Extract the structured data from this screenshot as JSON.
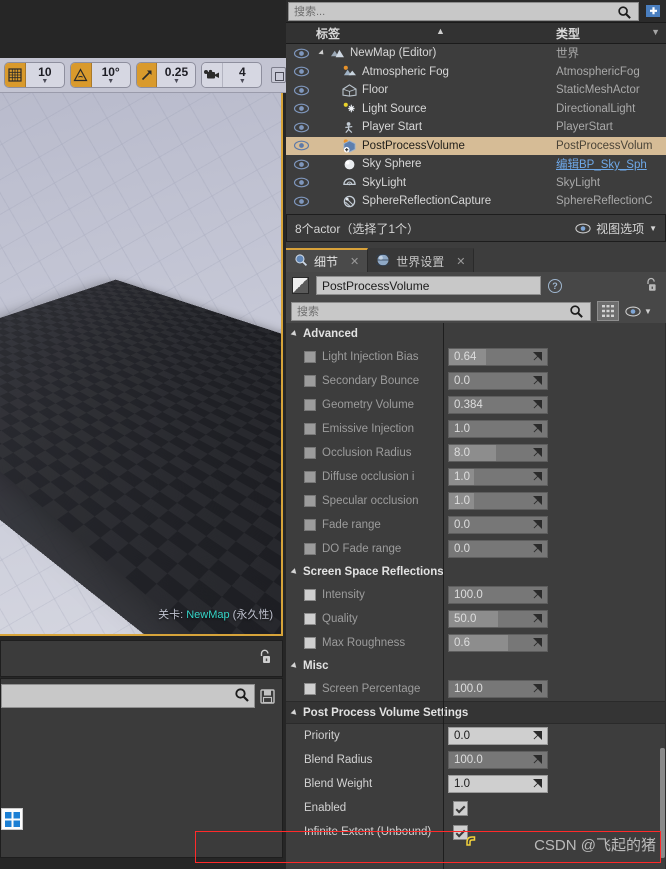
{
  "viewport_toolbar": {
    "grid_snap": {
      "icon": "grid-icon",
      "value": "10"
    },
    "angle_snap": {
      "icon": "angle-icon",
      "value": "10°"
    },
    "scale_snap": {
      "icon": "scale-arrow-icon",
      "value": "0.25"
    },
    "camera_speed": {
      "icon": "camera-icon",
      "value": "4"
    }
  },
  "viewport": {
    "level_prefix": "关卡:",
    "level_name": "NewMap",
    "level_suffix": "(永久性)"
  },
  "outliner": {
    "search_placeholder": "搜索...",
    "search_value": "",
    "columns": {
      "label": "标签",
      "type": "类型"
    },
    "rows": [
      {
        "name": "NewMap (Editor)",
        "type": "世界",
        "indent": 0,
        "icon": "world-icon",
        "selected": false,
        "link": false
      },
      {
        "name": "Atmospheric Fog",
        "type": "AtmosphericFog",
        "indent": 1,
        "icon": "fog-icon",
        "selected": false,
        "link": false
      },
      {
        "name": "Floor",
        "type": "StaticMeshActor",
        "indent": 1,
        "icon": "mesh-icon",
        "selected": false,
        "link": false
      },
      {
        "name": "Light Source",
        "type": "DirectionalLight",
        "indent": 1,
        "icon": "light-icon",
        "selected": false,
        "link": false
      },
      {
        "name": "Player Start",
        "type": "PlayerStart",
        "indent": 1,
        "icon": "player-icon",
        "selected": false,
        "link": false
      },
      {
        "name": "PostProcessVolume",
        "type": "PostProcessVolum",
        "indent": 1,
        "icon": "volume-icon",
        "selected": true,
        "link": false
      },
      {
        "name": "Sky Sphere",
        "type": "编辑BP_Sky_Sph",
        "indent": 1,
        "icon": "sphere-icon",
        "selected": false,
        "link": true
      },
      {
        "name": "SkyLight",
        "type": "SkyLight",
        "indent": 1,
        "icon": "skylight-icon",
        "selected": false,
        "link": false
      },
      {
        "name": "SphereReflectionCapture",
        "type": "SphereReflectionC",
        "indent": 1,
        "icon": "reflection-icon",
        "selected": false,
        "link": false
      }
    ],
    "footer_status": "8个actor（选择了1个）",
    "footer_viewoptions": "视图选项"
  },
  "details": {
    "tabs": [
      {
        "label": "细节",
        "icon": "magnifier-info-icon",
        "active": true
      },
      {
        "label": "世界设置",
        "icon": "globe-icon",
        "active": false
      }
    ],
    "object_name": "PostProcessVolume",
    "search_placeholder": "搜索",
    "search_value": "",
    "sections": [
      {
        "title": "Advanced",
        "band": false,
        "rows": [
          {
            "label": "Light Injection Bias",
            "value": "0.64",
            "fill": 38,
            "checkbox": "gray",
            "bright": false
          },
          {
            "label": "Secondary Bounce",
            "value": "0.0",
            "fill": 0,
            "checkbox": "gray",
            "bright": false
          },
          {
            "label": "Geometry Volume",
            "value": "0.384",
            "fill": 0,
            "checkbox": "gray",
            "bright": false
          },
          {
            "label": "Emissive Injection",
            "value": "1.0",
            "fill": 0,
            "checkbox": "gray",
            "bright": false
          },
          {
            "label": "Occlusion Radius",
            "value": "8.0",
            "fill": 48,
            "checkbox": "gray",
            "bright": false
          },
          {
            "label": "Diffuse occlusion i",
            "value": "1.0",
            "fill": 25,
            "checkbox": "gray",
            "bright": false
          },
          {
            "label": "Specular occlusion",
            "value": "1.0",
            "fill": 25,
            "checkbox": "gray",
            "bright": false
          },
          {
            "label": "Fade range",
            "value": "0.0",
            "fill": 0,
            "checkbox": "gray",
            "bright": false
          },
          {
            "label": "DO Fade range",
            "value": "0.0",
            "fill": 0,
            "checkbox": "gray",
            "bright": false
          }
        ]
      },
      {
        "title": "Screen Space Reflections",
        "band": false,
        "rows": [
          {
            "label": "Intensity",
            "value": "100.0",
            "fill": 0,
            "checkbox": "white",
            "bright": false
          },
          {
            "label": "Quality",
            "value": "50.0",
            "fill": 50,
            "checkbox": "white",
            "bright": false
          },
          {
            "label": "Max Roughness",
            "value": "0.6",
            "fill": 60,
            "checkbox": "white",
            "bright": false
          }
        ]
      },
      {
        "title": "Misc",
        "band": false,
        "rows": [
          {
            "label": "Screen Percentage",
            "value": "100.0",
            "fill": 0,
            "checkbox": "white",
            "bright": false
          }
        ]
      },
      {
        "title": "Post Process Volume Settings",
        "band": true,
        "rows": [
          {
            "label": "Priority",
            "value": "0.0",
            "fill": 0,
            "checkbox": "none",
            "bright": true
          },
          {
            "label": "Blend Radius",
            "value": "100.0",
            "fill": 0,
            "checkbox": "none",
            "bright": false
          },
          {
            "label": "Blend Weight",
            "value": "1.0",
            "fill": 0,
            "checkbox": "none",
            "bright": true
          },
          {
            "label": "Enabled",
            "value": "",
            "fill": 0,
            "checkbox": "toggle-checked",
            "bright": false
          },
          {
            "label": "Infinite Extent (Unbound)",
            "value": "",
            "fill": 0,
            "checkbox": "toggle-checked",
            "bright": false
          }
        ]
      }
    ]
  },
  "annotation": {
    "watermark": "CSDN @飞起的猪",
    "highlight_color": "#ff2a2a"
  }
}
